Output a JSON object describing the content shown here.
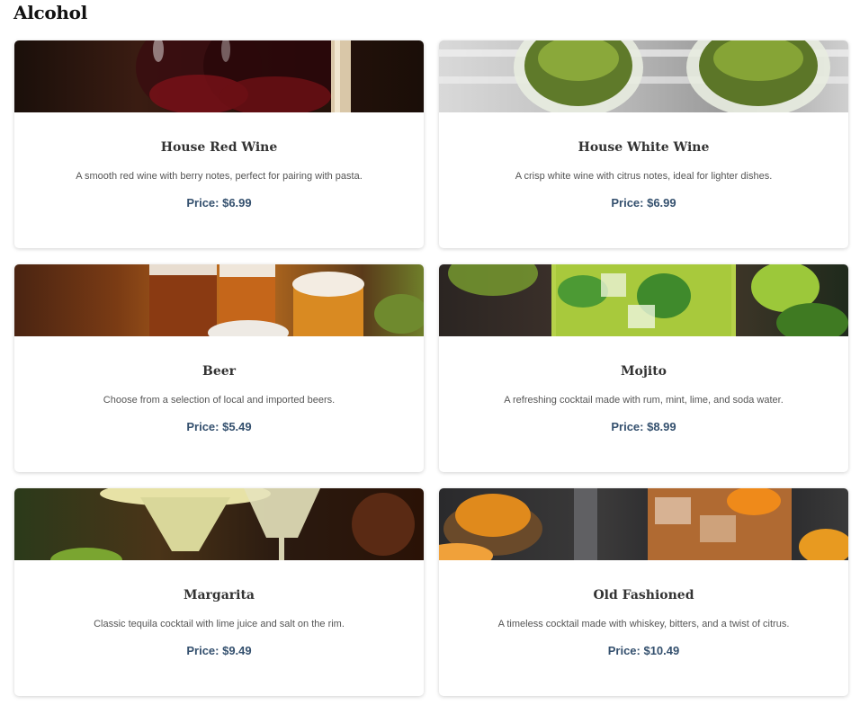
{
  "section": {
    "title": "Alcohol"
  },
  "items": [
    {
      "name": "House Red Wine",
      "description": "A smooth red wine with berry notes, perfect for pairing with pasta.",
      "price": "Price: $6.99",
      "image": "red-wine-glasses-image"
    },
    {
      "name": "House White Wine",
      "description": "A crisp white wine with citrus notes, ideal for lighter dishes.",
      "price": "Price: $6.99",
      "image": "white-wine-glasses-image"
    },
    {
      "name": "Beer",
      "description": "Choose from a selection of local and imported beers.",
      "price": "Price: $5.49",
      "image": "beer-glasses-image"
    },
    {
      "name": "Mojito",
      "description": "A refreshing cocktail made with rum, mint, lime, and soda water.",
      "price": "Price: $8.99",
      "image": "mojito-glass-image"
    },
    {
      "name": "Margarita",
      "description": "Classic tequila cocktail with lime juice and salt on the rim.",
      "price": "Price: $9.49",
      "image": "margarita-glasses-image"
    },
    {
      "name": "Old Fashioned",
      "description": "A timeless cocktail made with whiskey, bitters, and a twist of citrus.",
      "price": "Price: $10.49",
      "image": "old-fashioned-glass-image"
    }
  ],
  "colors": {
    "price": "#34506e",
    "heading": "#333333",
    "description": "#555555"
  }
}
